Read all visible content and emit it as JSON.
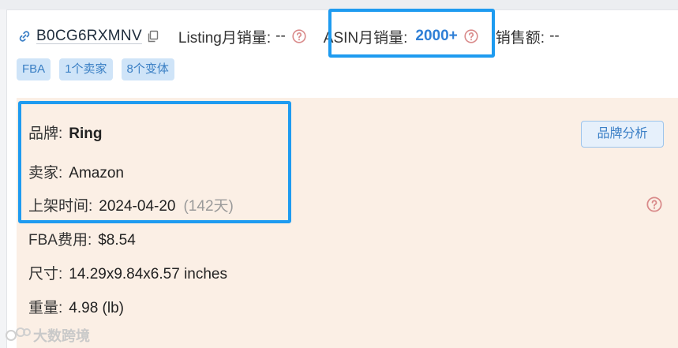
{
  "product": {
    "asin": "B0CG6RXMNV",
    "listing_sales_label": "Listing月销量:",
    "listing_sales_value": "--",
    "asin_sales_label": "ASIN月销量:",
    "asin_sales_value": "2000+",
    "revenue_label": "销售额:",
    "revenue_value": "--"
  },
  "tags": [
    "FBA",
    "1个卖家",
    "8个变体"
  ],
  "details": {
    "brand_label": "品牌:",
    "brand_value": "Ring",
    "seller_label": "卖家:",
    "seller_value": "Amazon",
    "listed_label": "上架时间:",
    "listed_value": "2024-04-20",
    "listed_days": "(142天)",
    "fba_fee_label": "FBA费用:",
    "fba_fee_value": "$8.54",
    "size_label": "尺寸:",
    "size_value": "14.29x9.84x6.57 inches",
    "weight_label": "重量:",
    "weight_value": "4.98 (lb)"
  },
  "buttons": {
    "brand_analysis": "品牌分析"
  },
  "watermark": {
    "text": "大数跨境"
  },
  "colors": {
    "accent": "#2f7fd6",
    "highlight": "#1e9bf0",
    "panel_bg": "#fbefe5",
    "tag_bg": "#cfe4f8",
    "help_icon": "#d9534f"
  }
}
